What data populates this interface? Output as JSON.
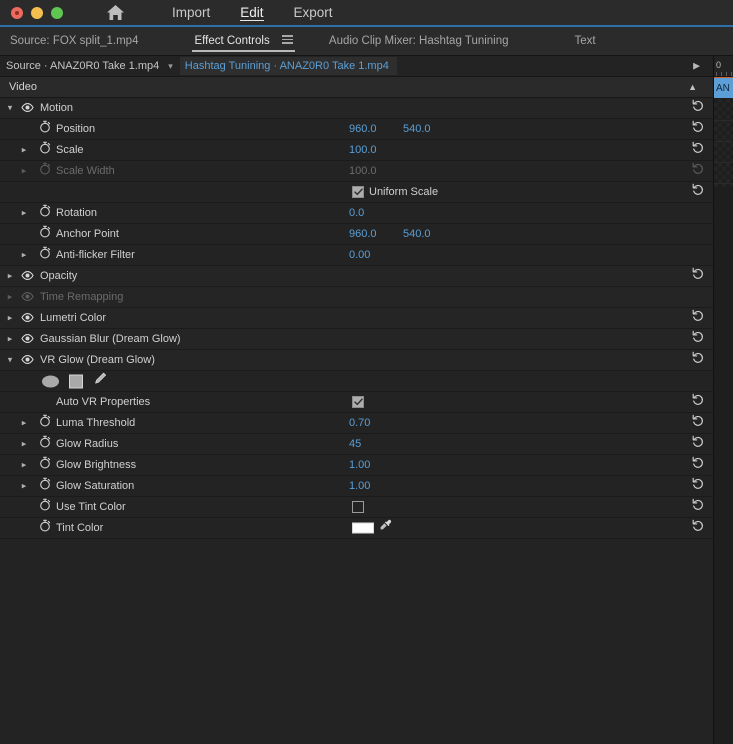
{
  "titlebar": {
    "traffic_lights": [
      "close",
      "minimize",
      "zoom"
    ],
    "home_icon": "home-icon",
    "menus": [
      {
        "label": "Import",
        "active": false
      },
      {
        "label": "Edit",
        "active": true
      },
      {
        "label": "Export",
        "active": false
      }
    ]
  },
  "panel_tabs": [
    {
      "label": "Source: FOX split_1.mp4",
      "active": false
    },
    {
      "label": "Effect Controls",
      "active": true,
      "has_menu": true
    },
    {
      "label": "Audio Clip Mixer: Hashtag Tunining",
      "active": false
    },
    {
      "label": "Text",
      "active": false
    }
  ],
  "source_bar": {
    "source_label": "Source · ANAZ0R0 Take 1.mp4",
    "caret_icon": "chevron-down-icon",
    "clip_label": "Hashtag Tunining · ANAZ0R0 Take 1.mp4",
    "play_icon": "play-icon"
  },
  "video_header": {
    "label": "Video",
    "collapse_icon": "chevron-up-icon"
  },
  "timeline": {
    "ruler_label": "0",
    "clip_label": "AN"
  },
  "colors": {
    "value_blue": "#5b9fd6",
    "panel_bg": "#232323",
    "row_sep": "#1b1b1b",
    "accent_border": "#2f6fa8",
    "tint_swatch": "#ffffff"
  },
  "properties": [
    {
      "id": "motion",
      "label": "Motion",
      "type": "group",
      "indent": 0,
      "twirl": "down",
      "eye": true,
      "reset": true
    },
    {
      "id": "position",
      "label": "Position",
      "type": "value2",
      "indent": 1,
      "twirl": null,
      "stopwatch": true,
      "v1": "960.0",
      "v2": "540.0",
      "reset": true
    },
    {
      "id": "scale",
      "label": "Scale",
      "type": "value1",
      "indent": 1,
      "twirl": "right",
      "stopwatch": true,
      "v1": "100.0",
      "reset": true
    },
    {
      "id": "scale-width",
      "label": "Scale Width",
      "type": "value1",
      "indent": 1,
      "twirl": "right",
      "stopwatch": true,
      "v1": "100.0",
      "reset": true,
      "disabled": true
    },
    {
      "id": "uniform-scale",
      "label": "Uniform Scale",
      "type": "checkbox",
      "indent": 1,
      "checked": true,
      "reset": true
    },
    {
      "id": "rotation",
      "label": "Rotation",
      "type": "value1",
      "indent": 1,
      "twirl": "right",
      "stopwatch": true,
      "v1": "0.0",
      "reset": false
    },
    {
      "id": "anchor-point",
      "label": "Anchor Point",
      "type": "value2",
      "indent": 1,
      "twirl": null,
      "stopwatch": true,
      "v1": "960.0",
      "v2": "540.0",
      "reset": false
    },
    {
      "id": "anti-flicker-filter",
      "label": "Anti-flicker Filter",
      "type": "value1",
      "indent": 1,
      "twirl": "right",
      "stopwatch": true,
      "v1": "0.00",
      "reset": false
    },
    {
      "id": "opacity",
      "label": "Opacity",
      "type": "group",
      "indent": 0,
      "twirl": "right",
      "eye": true,
      "reset": true
    },
    {
      "id": "time-remapping",
      "label": "Time Remapping",
      "type": "group",
      "indent": 0,
      "twirl": "right",
      "eye": true,
      "reset": false,
      "disabled": true
    },
    {
      "id": "lumetri-color",
      "label": "Lumetri Color",
      "type": "group",
      "indent": 0,
      "twirl": "right",
      "eye": true,
      "reset": true
    },
    {
      "id": "gaussian-blur",
      "label": "Gaussian Blur (Dream Glow)",
      "type": "group",
      "indent": 0,
      "twirl": "right",
      "eye": true,
      "reset": true
    },
    {
      "id": "vr-glow",
      "label": "VR Glow (Dream Glow)",
      "type": "group",
      "indent": 0,
      "twirl": "down",
      "eye": true,
      "reset": true
    },
    {
      "id": "mask-tools",
      "label": "",
      "type": "masktools",
      "indent": 1,
      "tools": [
        "ellipse-mask-icon",
        "rectangle-mask-icon",
        "pen-mask-icon"
      ],
      "reset": false
    },
    {
      "id": "auto-vr-properties",
      "label": "Auto VR Properties",
      "type": "checkbox-row",
      "indent": 1,
      "checked": true,
      "reset": true
    },
    {
      "id": "luma-threshold",
      "label": "Luma Threshold",
      "type": "value1",
      "indent": 1,
      "twirl": "right",
      "stopwatch": true,
      "v1": "0.70",
      "reset": true
    },
    {
      "id": "glow-radius",
      "label": "Glow Radius",
      "type": "value1",
      "indent": 1,
      "twirl": "right",
      "stopwatch": true,
      "v1": "45",
      "reset": true
    },
    {
      "id": "glow-brightness",
      "label": "Glow Brightness",
      "type": "value1",
      "indent": 1,
      "twirl": "right",
      "stopwatch": true,
      "v1": "1.00",
      "reset": true
    },
    {
      "id": "glow-saturation",
      "label": "Glow Saturation",
      "type": "value1",
      "indent": 1,
      "twirl": "right",
      "stopwatch": true,
      "v1": "1.00",
      "reset": true
    },
    {
      "id": "use-tint-color",
      "label": "Use Tint Color",
      "type": "checkbox-row",
      "indent": 1,
      "twirl": null,
      "stopwatch": true,
      "checked": false,
      "reset": true
    },
    {
      "id": "tint-color",
      "label": "Tint Color",
      "type": "color",
      "indent": 1,
      "twirl": null,
      "stopwatch": true,
      "swatch": "#ffffff",
      "reset": true
    }
  ]
}
